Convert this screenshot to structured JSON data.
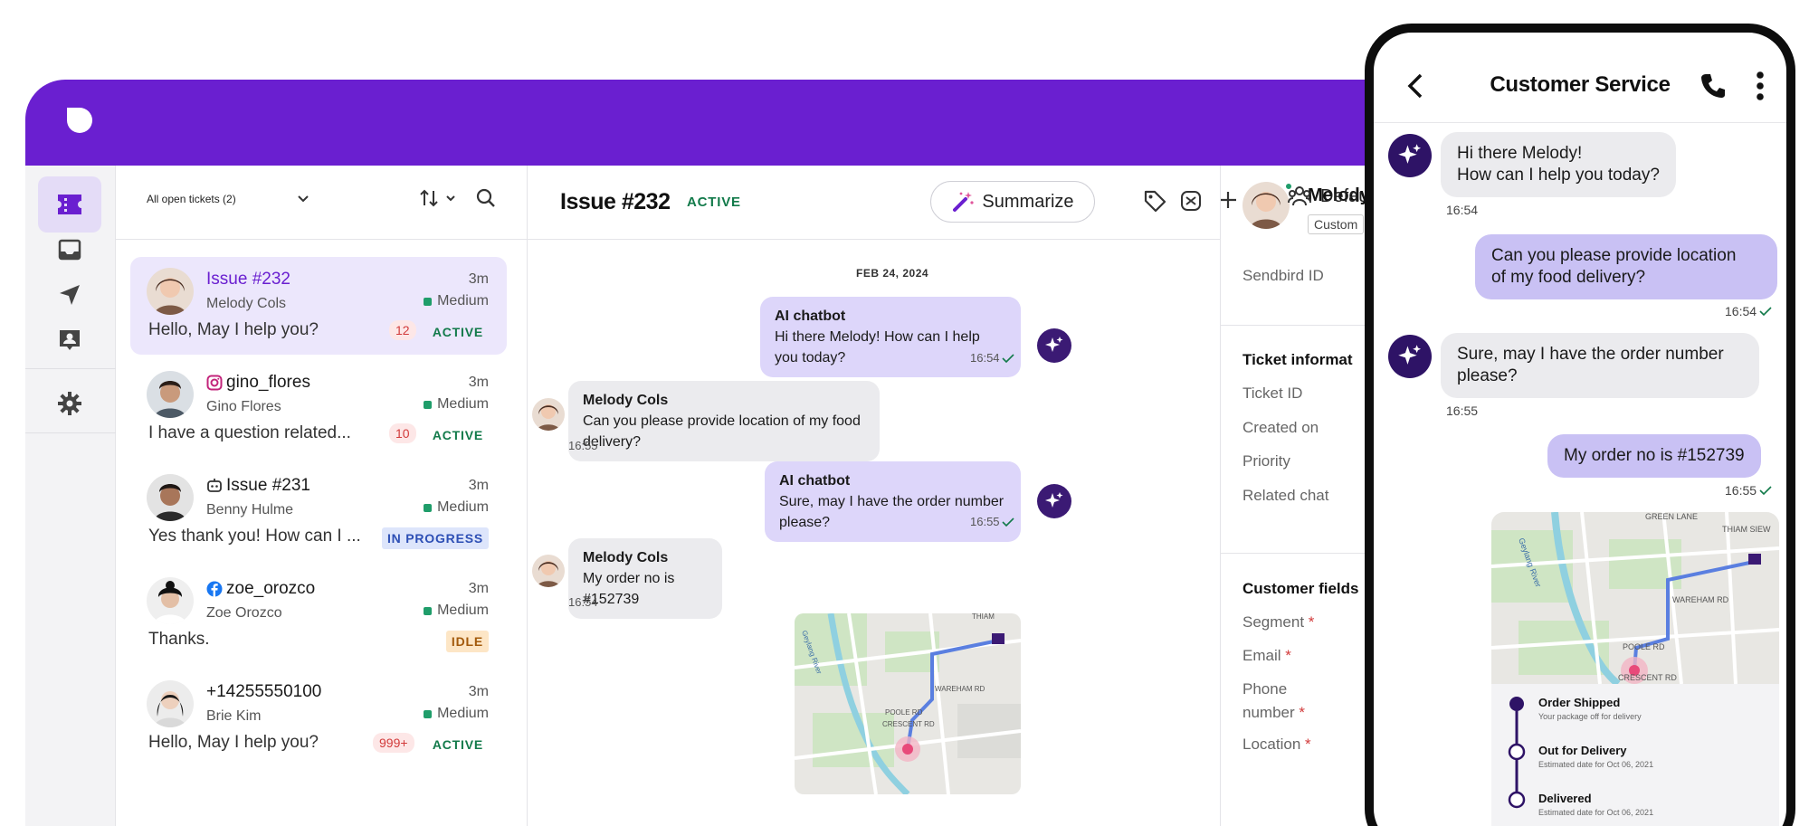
{
  "sidebar": {
    "items": [
      {
        "icon": "ticket-icon",
        "active": true
      },
      {
        "icon": "inbox-icon",
        "active": false
      },
      {
        "icon": "send-icon",
        "active": false
      },
      {
        "icon": "contact-icon",
        "active": false
      },
      {
        "icon": "gear-icon",
        "active": false
      }
    ]
  },
  "ticket_list": {
    "filter_label": "All open tickets (2)",
    "tickets": [
      {
        "name": "Issue #232",
        "channel_icon": "none",
        "sub": "Melody Cols",
        "time": "3m",
        "priority": "Medium",
        "message": "Hello, May I help you?",
        "count": "12",
        "status": "ACTIVE",
        "selected": true
      },
      {
        "name": "gino_flores",
        "channel_icon": "instagram-icon",
        "sub": "Gino Flores",
        "time": "3m",
        "priority": "Medium",
        "message": "I have a question related...",
        "count": "10",
        "status": "ACTIVE",
        "selected": false
      },
      {
        "name": "Issue #231",
        "channel_icon": "bot-icon",
        "sub": "Benny Hulme",
        "time": "3m",
        "priority": "Medium",
        "message": "Yes thank you! How can I ...",
        "count": "",
        "status": "IN PROGRESS",
        "selected": false
      },
      {
        "name": "zoe_orozco",
        "channel_icon": "facebook-icon",
        "sub": "Zoe Orozco",
        "time": "3m",
        "priority": "Medium",
        "message": "Thanks.",
        "count": "",
        "status": "IDLE",
        "selected": false
      },
      {
        "name": "+14255550100",
        "channel_icon": "none",
        "sub": "Brie Kim",
        "time": "3m",
        "priority": "Medium",
        "message": "Hello, May I help you?",
        "count": "999+",
        "status": "ACTIVE",
        "selected": false
      }
    ]
  },
  "chat": {
    "title": "Issue #232",
    "status": "ACTIVE",
    "summarize_label": "Summarize",
    "default_label": "Default",
    "date": "FEB 24, 2024",
    "messages": [
      {
        "sender": "AI chatbot",
        "text": "Hi there Melody! How can I help you today?",
        "time": "16:54",
        "from": "bot"
      },
      {
        "sender": "Melody Cols",
        "text": "Can you please provide location of my food delivery?",
        "time": "16:55",
        "from": "user"
      },
      {
        "sender": "AI chatbot",
        "text": "Sure, may I have the order number please?",
        "time": "16:55",
        "from": "bot"
      },
      {
        "sender": "Melody Cols",
        "text": "My order no is #152739",
        "time": "16:54",
        "from": "user"
      }
    ],
    "map_labels": [
      "THIAM",
      "WAREHAM RD",
      "POOLE RD",
      "CRESCENT RD",
      "Geylang River"
    ]
  },
  "details": {
    "name": "Melody",
    "tag": "Custom",
    "sendbird_label": "Sendbird ID",
    "ticket_section": "Ticket informat",
    "ticket_fields": [
      "Ticket ID",
      "Created on",
      "Priority",
      "Related chat"
    ],
    "customer_section": "Customer fields",
    "customer_fields": [
      "Segment",
      "Email",
      "Phone",
      "number",
      "Location"
    ],
    "required_mark": "*"
  },
  "phone": {
    "title": "Customer Service",
    "messages": [
      {
        "text_lines": [
          "Hi there Melody!",
          "How can I help you today?"
        ],
        "time": "16:54",
        "from": "bot"
      },
      {
        "text_lines": [
          "Can you please provide location",
          "of my food delivery?"
        ],
        "time": "16:54",
        "from": "user"
      },
      {
        "text_lines": [
          "Sure, may I have the order number",
          "please?"
        ],
        "time": "16:55",
        "from": "bot"
      },
      {
        "text_lines": [
          "My order no is #152739"
        ],
        "time": "16:55",
        "from": "user"
      }
    ],
    "map_labels": [
      "GREEN LANE",
      "THIAM SIEW",
      "WAREHAM RD",
      "POOLE RD",
      "CRESCENT RD",
      "Geylang River"
    ],
    "tracking": [
      {
        "title": "Order Shipped",
        "sub": "Your package off for delivery",
        "done": true
      },
      {
        "title": "Out for Delivery",
        "sub": "Estimated date for Oct 06, 2021",
        "done": false
      },
      {
        "title": "Delivered",
        "sub": "Estimated date for Oct 06, 2021",
        "done": false
      }
    ]
  },
  "colors": {
    "brand": "#6a1fd0",
    "bot_bubble": "#ddd6fa",
    "user_bubble": "#ebebee",
    "status_active": "#127a4a"
  }
}
